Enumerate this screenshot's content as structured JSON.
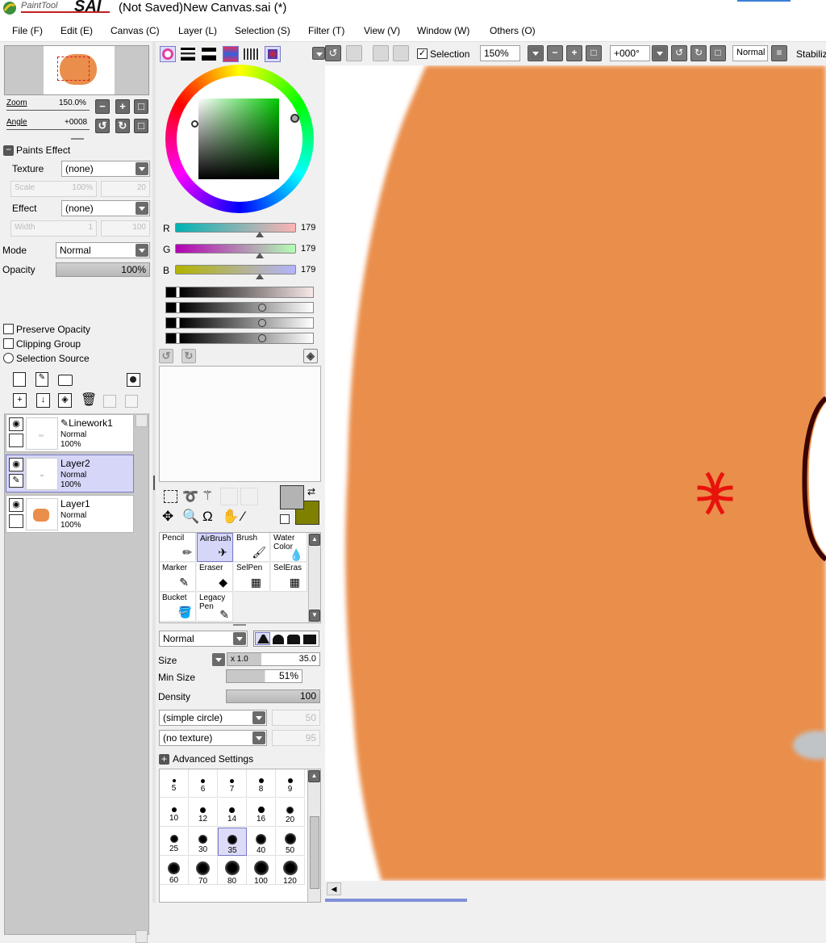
{
  "app": {
    "logo_text": "PaintTool",
    "logo_brand": "SAI",
    "window_title": "(Not Saved)New Canvas.sai (*)"
  },
  "menu": [
    "File (F)",
    "Edit (E)",
    "Canvas (C)",
    "Layer (L)",
    "Selection (S)",
    "Filter (T)",
    "View (V)",
    "Window (W)",
    "Others (O)"
  ],
  "navigator": {
    "zoom_label": "Zoom",
    "zoom_value": "150.0%",
    "angle_label": "Angle",
    "angle_value": "+0008"
  },
  "paints_effect": {
    "header": "Paints Effect",
    "texture_label": "Texture",
    "texture_value": "(none)",
    "scale_label": "Scale",
    "scale_value": "100%",
    "scale_num": "20",
    "effect_label": "Effect",
    "effect_value": "(none)",
    "width_label": "Width",
    "width_value": "1",
    "width_num": "100"
  },
  "layer_props": {
    "mode_label": "Mode",
    "mode_value": "Normal",
    "opacity_label": "Opacity",
    "opacity_value": "100%",
    "preserve_opacity": "Preserve Opacity",
    "clipping_group": "Clipping Group",
    "selection_source": "Selection Source"
  },
  "layers": [
    {
      "name": "Linework1",
      "mode": "Normal",
      "opacity": "100%",
      "selected": false
    },
    {
      "name": "Layer2",
      "mode": "Normal",
      "opacity": "100%",
      "selected": true
    },
    {
      "name": "Layer1",
      "mode": "Normal",
      "opacity": "100%",
      "selected": false
    }
  ],
  "color": {
    "r_label": "R",
    "r_value": "179",
    "g_label": "G",
    "g_value": "179",
    "b_label": "B",
    "b_value": "179",
    "fg_color": "#b3b3b3",
    "bg_color": "#808000"
  },
  "tools": [
    {
      "name": "Pencil"
    },
    {
      "name": "AirBrush"
    },
    {
      "name": "Brush"
    },
    {
      "name": "Water Color"
    },
    {
      "name": "Marker"
    },
    {
      "name": "Eraser"
    },
    {
      "name": "SelPen"
    },
    {
      "name": "SelEras"
    },
    {
      "name": "Bucket"
    },
    {
      "name": "Legacy Pen"
    }
  ],
  "brush": {
    "blend_mode": "Normal",
    "size_label": "Size",
    "size_mult": "x 1.0",
    "size_value": "35.0",
    "min_size_label": "Min Size",
    "min_size_value": "51%",
    "density_label": "Density",
    "density_value": "100",
    "shape_value": "(simple circle)",
    "shape_num": "50",
    "texture_value": "(no texture)",
    "texture_num": "95",
    "advanced_label": "Advanced Settings"
  },
  "brush_sizes": [
    "5",
    "6",
    "7",
    "8",
    "9",
    "10",
    "12",
    "14",
    "16",
    "20",
    "25",
    "30",
    "35",
    "40",
    "50",
    "60",
    "70",
    "80",
    "100",
    "120"
  ],
  "selected_brush_size": "35",
  "toolbar": {
    "selection_label": "Selection",
    "zoom_value": "150%",
    "angle_value": "+000°",
    "blend_value": "Normal",
    "stabilizer_label": "Stabiliz"
  },
  "canvas": {
    "fill_color": "#ea8e4c",
    "anger_symbol_color": "#e8140c"
  }
}
